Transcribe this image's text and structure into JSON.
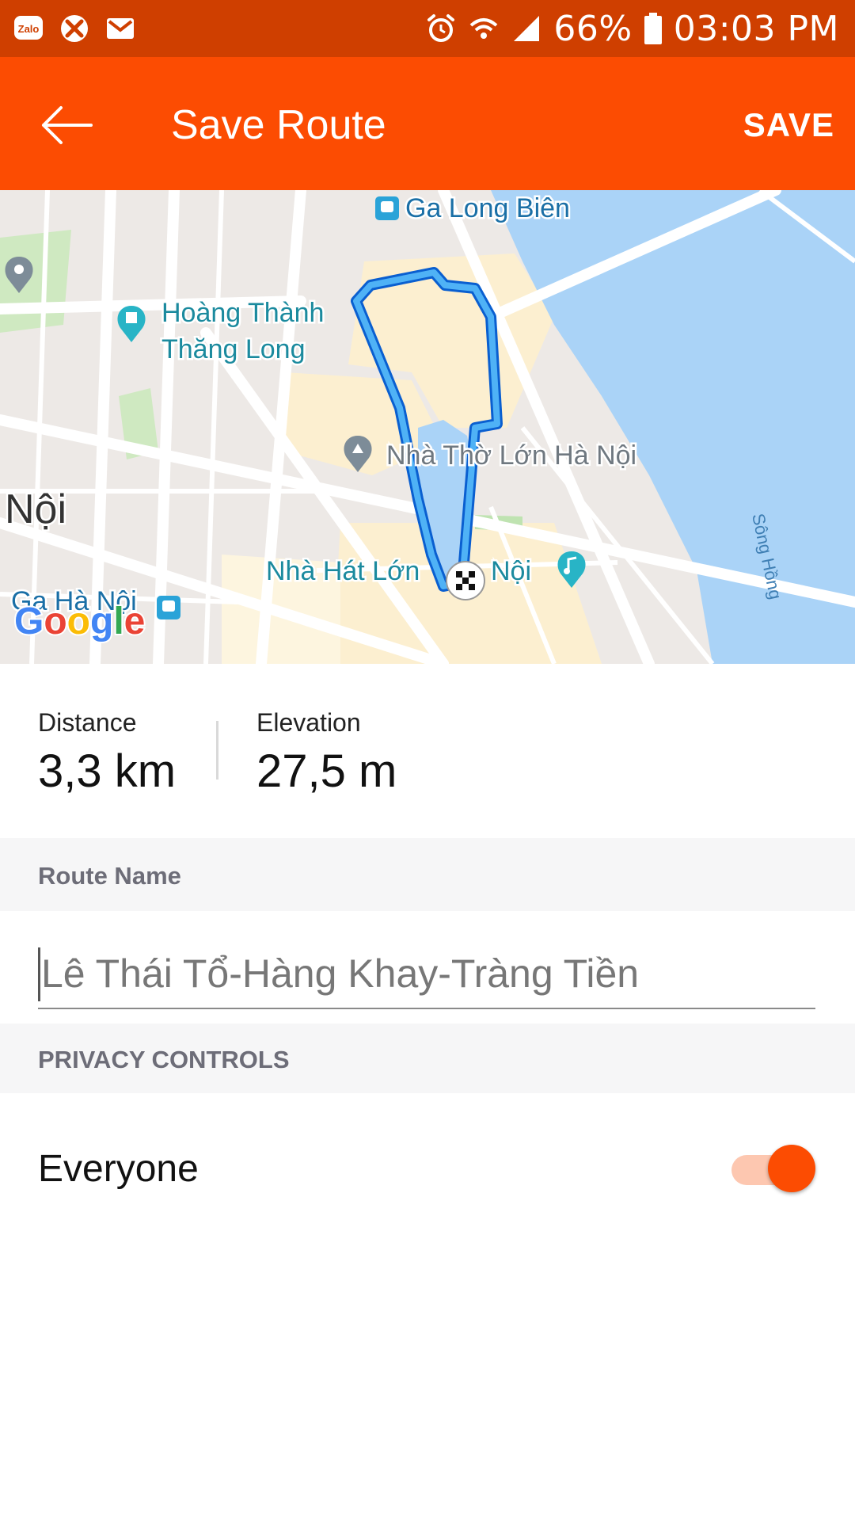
{
  "status_bar": {
    "battery": "66%",
    "time": "03:03 PM",
    "left_icons": [
      "zalo-icon",
      "missed-call-icon",
      "gmail-icon"
    ],
    "zalo_text": "Zalo"
  },
  "app_bar": {
    "title": "Save Route",
    "save_label": "SAVE",
    "color": "#fc4c02"
  },
  "map": {
    "labels": {
      "ga_long_bien": "Ga Long Biên",
      "hoang_thanh_1": "Hoàng Thành",
      "hoang_thanh_2": "Thăng Long",
      "nha_tho": "Nhà Thờ Lớn Hà Nội",
      "noi": "Nội",
      "nha_hat_1": "Nhà Hát Lớn",
      "nha_hat_2": "Nội",
      "ga_ha_noi": "Ga Hà Nội",
      "song_hong": "Sông Hồng",
      "google": "Google"
    },
    "route_color": "#2e9cf3"
  },
  "stats": {
    "distance_label": "Distance",
    "distance_value": "3,3 km",
    "elevation_label": "Elevation",
    "elevation_value": "27,5 m"
  },
  "route_name": {
    "header": "Route Name",
    "value": "Lê Thái Tổ-Hàng Khay-Tràng Tiền"
  },
  "privacy": {
    "header": "PRIVACY CONTROLS",
    "option_label": "Everyone",
    "toggle_on": true
  }
}
